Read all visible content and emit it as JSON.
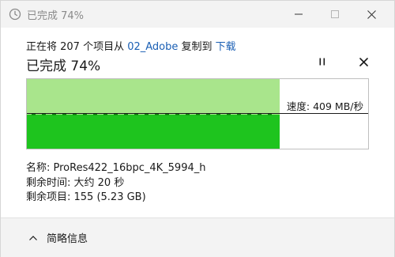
{
  "window": {
    "title": "已完成 74%",
    "min_label": "最小化",
    "max_label": "最大化",
    "close_label": "关闭"
  },
  "header": {
    "prefix": "正在将 207 个项目从 ",
    "source": "02_Adobe",
    "middle": " 复制到 ",
    "destination": "下载",
    "percent_text": "已完成 74%",
    "progress": 0.74
  },
  "graph": {
    "speed_label": "速度: 409 MB/秒"
  },
  "details": {
    "name_label": "名称: ",
    "name_value": "ProRes422_16bpc_4K_5994_h",
    "time_label": "剩余时间: ",
    "time_value": "大约 20 秒",
    "items_label": "剩余项目: ",
    "items_value": "155 (5.23 GB)"
  },
  "footer": {
    "toggle_label": "简略信息"
  },
  "colors": {
    "accent_link": "#1a5fb4",
    "progress_light": "#a9e58c",
    "progress_dark": "#1ec41e"
  }
}
